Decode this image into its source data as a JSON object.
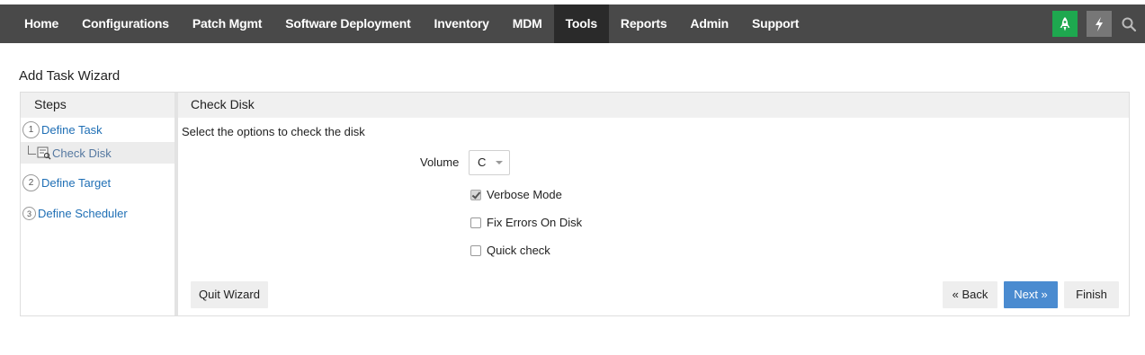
{
  "nav": {
    "items": [
      {
        "label": "Home"
      },
      {
        "label": "Configurations"
      },
      {
        "label": "Patch Mgmt"
      },
      {
        "label": "Software Deployment"
      },
      {
        "label": "Inventory"
      },
      {
        "label": "MDM"
      },
      {
        "label": "Tools",
        "active": true
      },
      {
        "label": "Reports"
      },
      {
        "label": "Admin"
      },
      {
        "label": "Support"
      }
    ],
    "icons": [
      "rocket-icon",
      "bolt-icon",
      "search-icon"
    ],
    "colors": {
      "bar": "#494949",
      "active": "#2a2a2a",
      "rocket_bg": "#1ea84f",
      "bolt_bg": "#777777"
    }
  },
  "page": {
    "title": "Add Task Wizard"
  },
  "wizard": {
    "steps_header": "Steps",
    "steps": [
      {
        "number": "1",
        "label": "Define Task"
      },
      {
        "label": "Check Disk",
        "sub": true,
        "icon": "disk-check-icon"
      },
      {
        "number": "2",
        "label": "Define Target"
      },
      {
        "number": "3",
        "label": "Define Scheduler"
      }
    ],
    "content_header": "Check Disk",
    "instruction": "Select the options to check the disk",
    "volume": {
      "label": "Volume",
      "value": "C"
    },
    "options": [
      {
        "label": "Verbose Mode",
        "checked": true
      },
      {
        "label": "Fix Errors On Disk",
        "checked": false
      },
      {
        "label": "Quick check",
        "checked": false
      }
    ],
    "buttons": {
      "quit": "Quit Wizard",
      "back": "« Back",
      "next": "Next »",
      "finish": "Finish"
    },
    "colors": {
      "link": "#1f6fb5",
      "next_bg": "#4a8bd0"
    }
  }
}
